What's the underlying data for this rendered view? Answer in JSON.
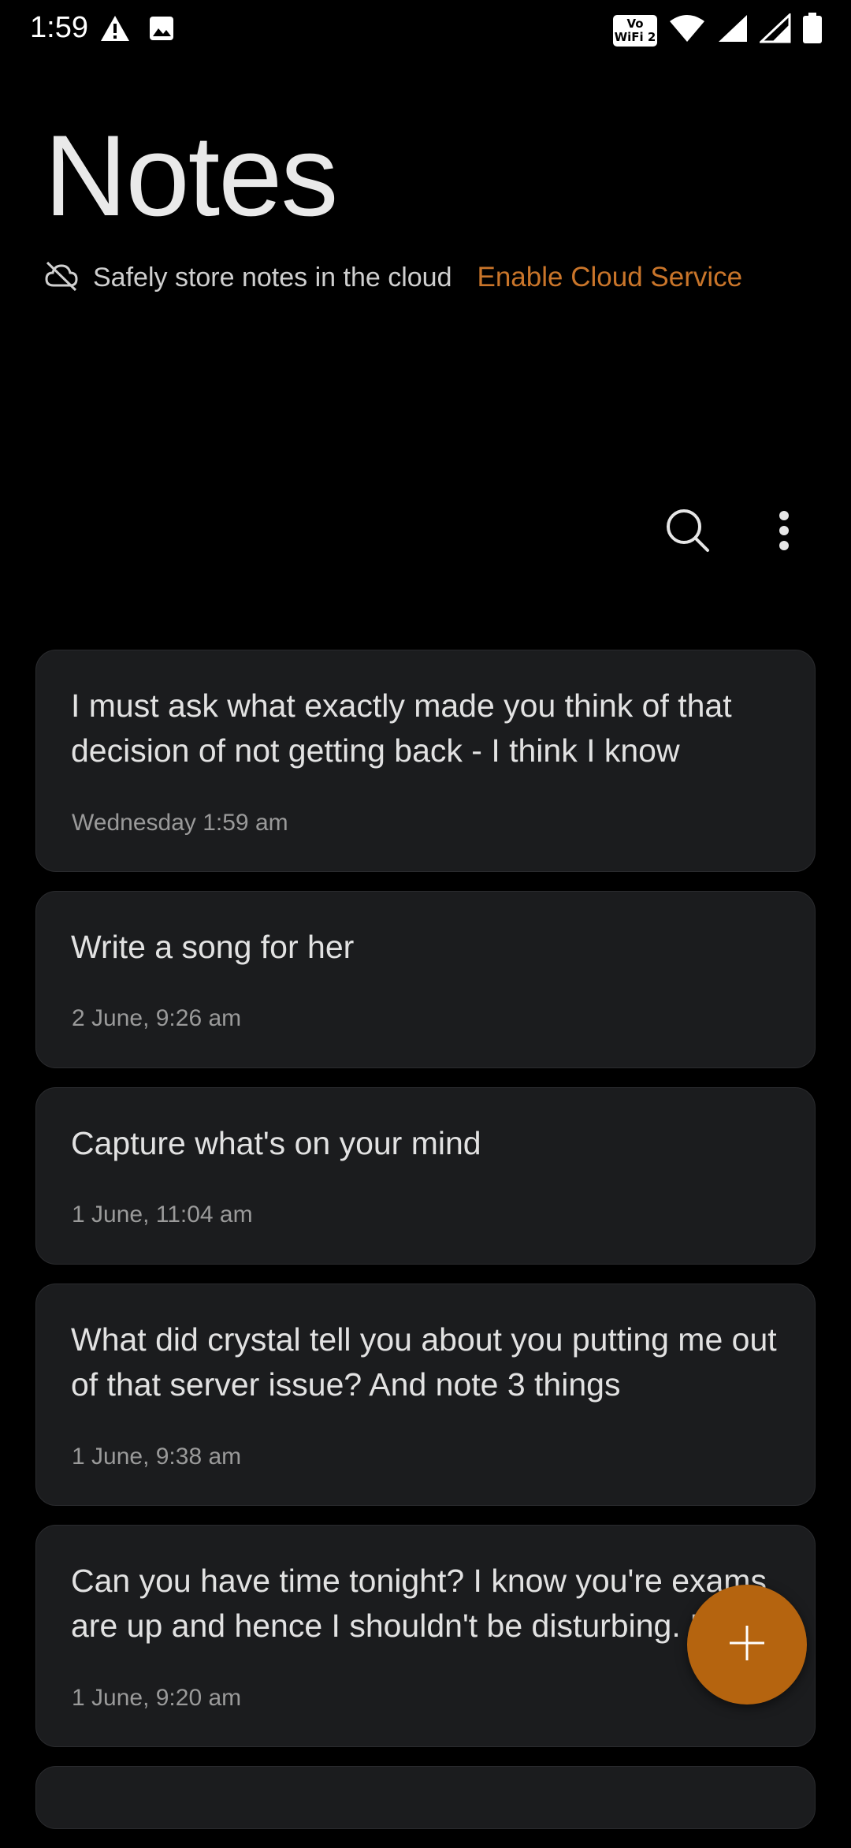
{
  "status_bar": {
    "time": "1:59",
    "vowifi_label": "Vo WiFi 2"
  },
  "header": {
    "title": "Notes",
    "cloud_text": "Safely store notes in the cloud",
    "cloud_link": "Enable Cloud Service"
  },
  "colors": {
    "accent": "#c9752a",
    "fab": "#b5640f",
    "card": "#1b1c1e",
    "background": "#000000"
  },
  "notes": [
    {
      "text": "I must ask what exactly made you think of that decision of not getting back - I think I know",
      "date": "Wednesday 1:59 am"
    },
    {
      "text": "Write a song for her",
      "date": "2 June, 9:26 am"
    },
    {
      "text": "Capture what's on your mind",
      "date": "1 June, 11:04 am"
    },
    {
      "text": "What did crystal tell you about you putting me out of that server issue? And note 3 things",
      "date": "1 June, 9:38 am"
    },
    {
      "text": "Can you have time tonight? I know you're exams are up and hence I shouldn't be disturbing. I",
      "date": "1 June, 9:20 am"
    }
  ],
  "icons": {
    "cloud_off": "cloud-off-icon",
    "search": "search-icon",
    "more": "more-vertical-icon",
    "add": "plus-icon"
  }
}
